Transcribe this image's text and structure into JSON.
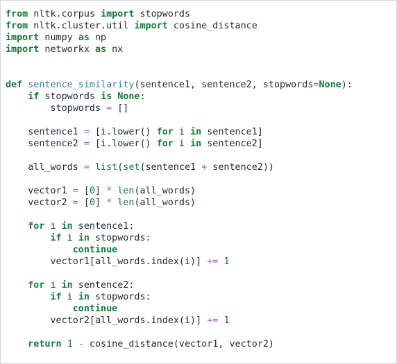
{
  "colors": {
    "background": "#ffffff",
    "text": "#1d2a36",
    "keyword": "#16793a",
    "function_name": "#2f7ea4",
    "operator": "#9a5ab8"
  },
  "code": {
    "lines": [
      [
        [
          "kw",
          "from"
        ],
        [
          "txt",
          " nltk.corpus "
        ],
        [
          "kw",
          "import"
        ],
        [
          "txt",
          " stopwords"
        ]
      ],
      [
        [
          "kw",
          "from"
        ],
        [
          "txt",
          " nltk.cluster.util "
        ],
        [
          "kw",
          "import"
        ],
        [
          "txt",
          " cosine_distance"
        ]
      ],
      [
        [
          "kw",
          "import"
        ],
        [
          "txt",
          " numpy "
        ],
        [
          "kw",
          "as"
        ],
        [
          "txt",
          " np"
        ]
      ],
      [
        [
          "kw",
          "import"
        ],
        [
          "txt",
          " networkx "
        ],
        [
          "kw",
          "as"
        ],
        [
          "txt",
          " nx"
        ]
      ],
      [],
      [],
      [
        [
          "kw",
          "def"
        ],
        [
          "txt",
          " "
        ],
        [
          "fn",
          "sentence_similarity"
        ],
        [
          "txt",
          "(sentence1, sentence2, stopwords"
        ],
        [
          "op",
          "="
        ],
        [
          "kw",
          "None"
        ],
        [
          "txt",
          "):"
        ]
      ],
      [
        [
          "txt",
          "    "
        ],
        [
          "kw",
          "if"
        ],
        [
          "txt",
          " stopwords "
        ],
        [
          "kw",
          "is"
        ],
        [
          "txt",
          " "
        ],
        [
          "kw",
          "None"
        ],
        [
          "txt",
          ":"
        ]
      ],
      [
        [
          "txt",
          "        stopwords "
        ],
        [
          "op",
          "="
        ],
        [
          "txt",
          " []"
        ]
      ],
      [],
      [
        [
          "txt",
          "    sentence1 "
        ],
        [
          "op",
          "="
        ],
        [
          "txt",
          " [i.lower() "
        ],
        [
          "kw",
          "for"
        ],
        [
          "txt",
          " i "
        ],
        [
          "kw",
          "in"
        ],
        [
          "txt",
          " sentence1]"
        ]
      ],
      [
        [
          "txt",
          "    sentence2 "
        ],
        [
          "op",
          "="
        ],
        [
          "txt",
          " [i.lower() "
        ],
        [
          "kw",
          "for"
        ],
        [
          "txt",
          " i "
        ],
        [
          "kw",
          "in"
        ],
        [
          "txt",
          " sentence2]"
        ]
      ],
      [],
      [
        [
          "txt",
          "    all_words "
        ],
        [
          "op",
          "="
        ],
        [
          "txt",
          " "
        ],
        [
          "bi",
          "list"
        ],
        [
          "txt",
          "("
        ],
        [
          "bi",
          "set"
        ],
        [
          "txt",
          "(sentence1 "
        ],
        [
          "op",
          "+"
        ],
        [
          "txt",
          " sentence2))"
        ]
      ],
      [],
      [
        [
          "txt",
          "    vector1 "
        ],
        [
          "op",
          "="
        ],
        [
          "txt",
          " ["
        ],
        [
          "num",
          "0"
        ],
        [
          "txt",
          "] "
        ],
        [
          "op",
          "*"
        ],
        [
          "txt",
          " "
        ],
        [
          "bi",
          "len"
        ],
        [
          "txt",
          "(all_words)"
        ]
      ],
      [
        [
          "txt",
          "    vector2 "
        ],
        [
          "op",
          "="
        ],
        [
          "txt",
          " ["
        ],
        [
          "num",
          "0"
        ],
        [
          "txt",
          "] "
        ],
        [
          "op",
          "*"
        ],
        [
          "txt",
          " "
        ],
        [
          "bi",
          "len"
        ],
        [
          "txt",
          "(all_words)"
        ]
      ],
      [],
      [
        [
          "txt",
          "    "
        ],
        [
          "kw",
          "for"
        ],
        [
          "txt",
          " i "
        ],
        [
          "kw",
          "in"
        ],
        [
          "txt",
          " sentence1:"
        ]
      ],
      [
        [
          "txt",
          "        "
        ],
        [
          "kw",
          "if"
        ],
        [
          "txt",
          " i "
        ],
        [
          "kw",
          "in"
        ],
        [
          "txt",
          " stopwords:"
        ]
      ],
      [
        [
          "txt",
          "            "
        ],
        [
          "kw",
          "continue"
        ]
      ],
      [
        [
          "txt",
          "        vector1[all_words.index(i)] "
        ],
        [
          "op",
          "+="
        ],
        [
          "txt",
          " "
        ],
        [
          "num",
          "1"
        ]
      ],
      [],
      [
        [
          "txt",
          "    "
        ],
        [
          "kw",
          "for"
        ],
        [
          "txt",
          " i "
        ],
        [
          "kw",
          "in"
        ],
        [
          "txt",
          " sentence2:"
        ]
      ],
      [
        [
          "txt",
          "        "
        ],
        [
          "kw",
          "if"
        ],
        [
          "txt",
          " i "
        ],
        [
          "kw",
          "in"
        ],
        [
          "txt",
          " stopwords:"
        ]
      ],
      [
        [
          "txt",
          "            "
        ],
        [
          "kw",
          "continue"
        ]
      ],
      [
        [
          "txt",
          "        vector2[all_words.index(i)] "
        ],
        [
          "op",
          "+="
        ],
        [
          "txt",
          " "
        ],
        [
          "num",
          "1"
        ]
      ],
      [],
      [
        [
          "txt",
          "    "
        ],
        [
          "kw",
          "return"
        ],
        [
          "txt",
          " "
        ],
        [
          "num",
          "1"
        ],
        [
          "txt",
          " "
        ],
        [
          "op",
          "-"
        ],
        [
          "txt",
          " cosine_distance(vector1, vector2)"
        ]
      ]
    ]
  }
}
